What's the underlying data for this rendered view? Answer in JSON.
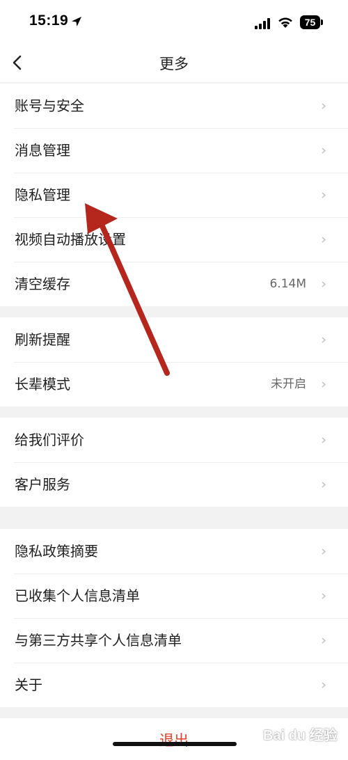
{
  "status_bar": {
    "time": "15:19",
    "battery_level": "75"
  },
  "nav": {
    "title": "更多"
  },
  "groups": [
    {
      "items": [
        {
          "label": "账号与安全",
          "value": ""
        },
        {
          "label": "消息管理",
          "value": ""
        },
        {
          "label": "隐私管理",
          "value": ""
        },
        {
          "label": "视频自动播放设置",
          "value": ""
        },
        {
          "label": "清空缓存",
          "value": "6.14M"
        }
      ]
    },
    {
      "items": [
        {
          "label": "刷新提醒",
          "value": ""
        },
        {
          "label": "长辈模式",
          "value": "未开启"
        }
      ]
    },
    {
      "items": [
        {
          "label": "给我们评价",
          "value": ""
        },
        {
          "label": "客户服务",
          "value": ""
        }
      ]
    },
    {
      "items": [
        {
          "label": "隐私政策摘要",
          "value": ""
        },
        {
          "label": "已收集个人信息清单",
          "value": ""
        },
        {
          "label": "与第三方共享个人信息清单",
          "value": ""
        },
        {
          "label": "关于",
          "value": ""
        }
      ]
    }
  ],
  "logout": {
    "label": "退出"
  },
  "watermark": {
    "text": "Bai du 经验"
  },
  "colors": {
    "accent_red": "#e3402a",
    "annotation_red": "#b5261d",
    "background": "#f2f2f2"
  }
}
